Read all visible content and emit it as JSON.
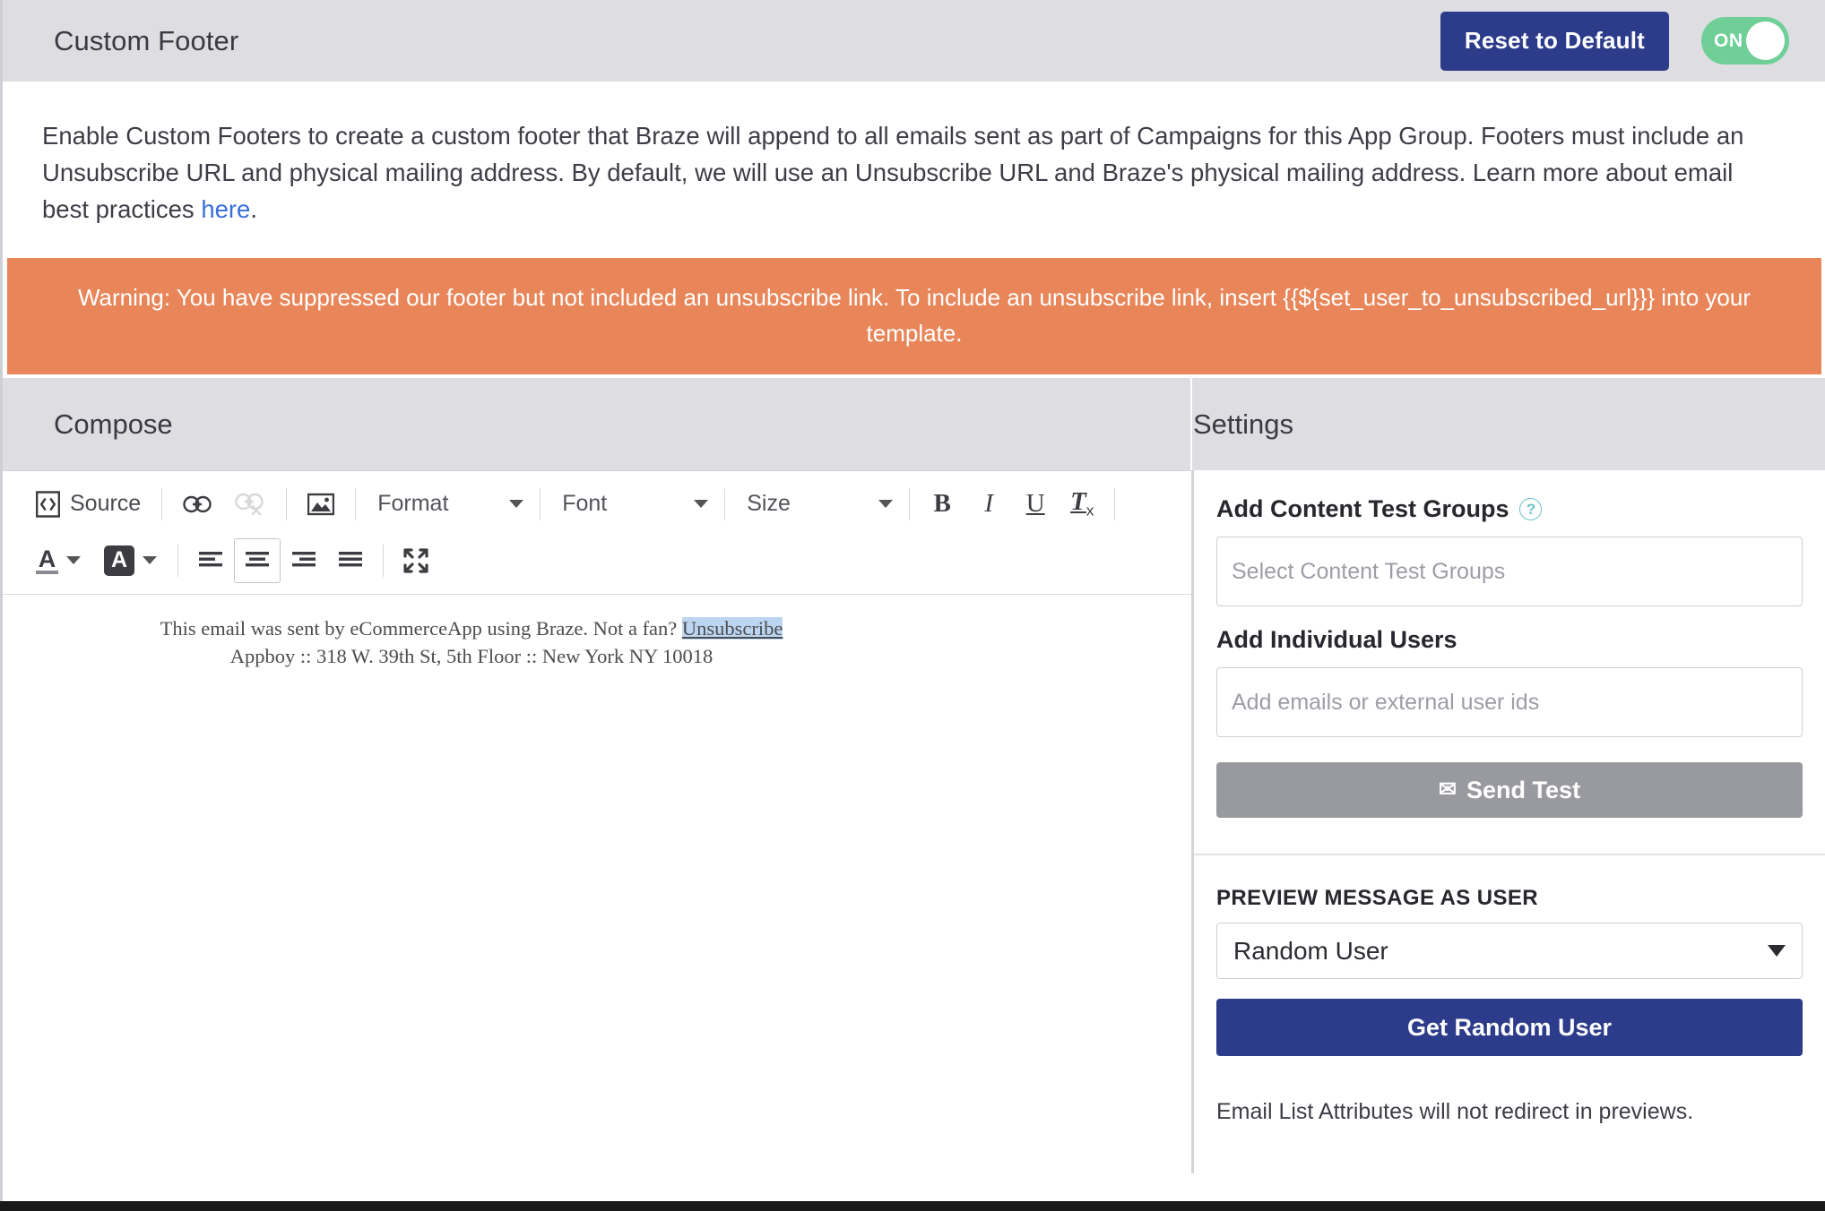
{
  "header": {
    "title": "Custom Footer",
    "reset_label": "Reset to Default",
    "toggle_label": "ON",
    "toggle_state": "on",
    "accent_blue": "#2c3b8a",
    "toggle_green": "#6fcf97"
  },
  "description": {
    "part1": "Enable Custom Footers to create a custom footer that Braze will append to all emails sent as part of Campaigns for this App Group. Footers must include an Unsubscribe URL and physical mailing address. By default, we will use an Unsubscribe URL and Braze's physical mailing address. Learn more about email best practices ",
    "link_text": "here",
    "part2": "."
  },
  "warning": {
    "text": "Warning: You have suppressed our footer but not included an unsubscribe link. To include an unsubscribe link, insert {{${set_user_to_unsubscribed_url}}} into your template.",
    "background": "#e8865a"
  },
  "sections": {
    "compose_title": "Compose",
    "settings_title": "Settings"
  },
  "toolbar": {
    "source_label": "Source",
    "format_label": "Format",
    "font_label": "Font",
    "size_label": "Size",
    "bold": "B",
    "italic": "I",
    "underline": "U",
    "remove_format": "T",
    "remove_format_sub": "x",
    "text_color": "A",
    "bg_color": "A"
  },
  "editor": {
    "line1_prefix": "This email was sent by eCommerceApp using Braze. Not a fan? ",
    "line1_unsubscribe": "Unsubscribe",
    "line2": "Appboy :: 318 W. 39th St, 5th Floor :: New York NY 10018"
  },
  "settings": {
    "content_test_groups_label": "Add Content Test Groups",
    "content_test_groups_placeholder": "Select Content Test Groups",
    "content_test_groups_value": "",
    "help_glyph": "?",
    "individual_users_label": "Add Individual Users",
    "individual_users_placeholder": "Add emails or external user ids",
    "individual_users_value": "",
    "send_test_label": "Send Test",
    "mail_glyph": "✉",
    "preview_label": "PREVIEW MESSAGE AS USER",
    "preview_selected": "Random User",
    "get_random_user_label": "Get Random User",
    "note": "Email List Attributes will not redirect in previews."
  }
}
